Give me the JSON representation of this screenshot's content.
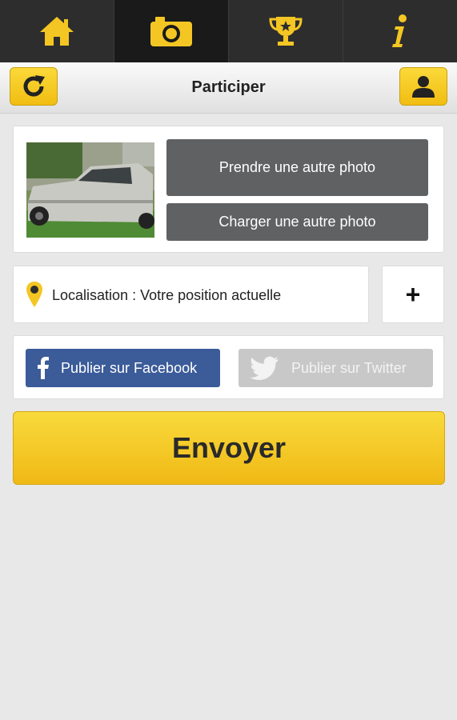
{
  "tabs": [
    {
      "icon": "home-icon",
      "active": false
    },
    {
      "icon": "camera-icon",
      "active": true
    },
    {
      "icon": "trophy-icon",
      "active": false
    },
    {
      "icon": "info-icon",
      "active": false
    }
  ],
  "header": {
    "title": "Participer",
    "left_icon": "refresh-icon",
    "right_icon": "user-icon"
  },
  "photo": {
    "thumbnail_icon": "car-photo",
    "take_label": "Prendre une autre photo",
    "upload_label": "Charger une autre photo"
  },
  "location": {
    "icon": "map-pin-icon",
    "text": "Localisation : Votre position actuelle",
    "add_label": "+"
  },
  "social": {
    "facebook_label": "Publier sur Facebook",
    "twitter_label": "Publier sur Twitter"
  },
  "submit": {
    "label": "Envoyer"
  },
  "colors": {
    "accent": "#f4c624",
    "tabbar": "#2d2d2d",
    "button_gray": "#5f6163",
    "facebook": "#3b5b99",
    "twitter_disabled": "#c8c8c8"
  }
}
